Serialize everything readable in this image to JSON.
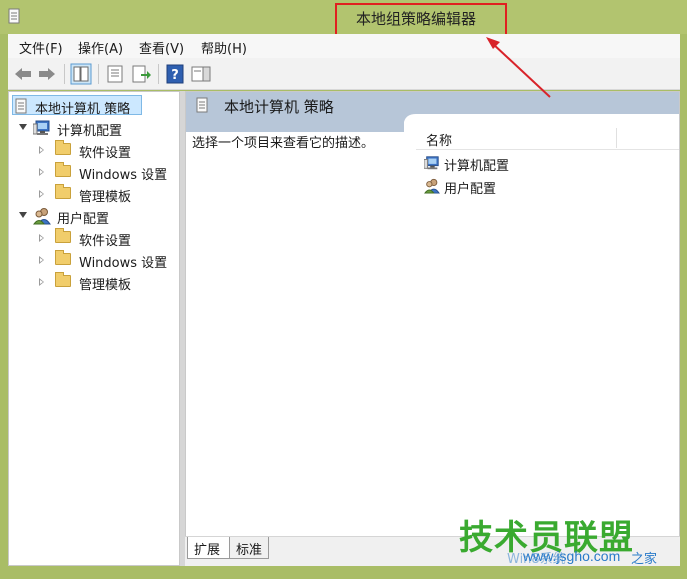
{
  "window": {
    "title": "本地组策略编辑器",
    "app_icon": "policy-document-icon"
  },
  "menubar": {
    "items": [
      "文件(F)",
      "操作(A)",
      "查看(V)",
      "帮助(H)"
    ]
  },
  "toolbar": {
    "buttons": [
      "back-arrow-icon",
      "forward-arrow-icon",
      "show-hide-tree-icon",
      "properties-icon",
      "export-list-icon",
      "help-icon",
      "show-action-pane-icon"
    ]
  },
  "tree": {
    "root": "本地计算机 策略",
    "computer_config": {
      "label": "计算机配置",
      "children": [
        "软件设置",
        "Windows 设置",
        "管理模板"
      ]
    },
    "user_config": {
      "label": "用户配置",
      "children": [
        "软件设置",
        "Windows 设置",
        "管理模板"
      ]
    }
  },
  "right_pane": {
    "header_title": "本地计算机 策略",
    "description": "选择一个项目来查看它的描述。",
    "column_name": "名称",
    "items": [
      "计算机配置",
      "用户配置"
    ]
  },
  "tabs": [
    "扩展",
    "标准"
  ],
  "watermark": {
    "main": "技术员联盟",
    "url": "www.jsgho.com",
    "prefix": "Win8系统",
    "suffix": "之家"
  },
  "colors": {
    "title_bar": "#b2c46f",
    "highlight_box": "#e02020",
    "selection": "#cce8ff",
    "header_band": "#b7c6d8",
    "watermark_green": "#3aaa30",
    "watermark_blue": "#2a7bc9"
  }
}
